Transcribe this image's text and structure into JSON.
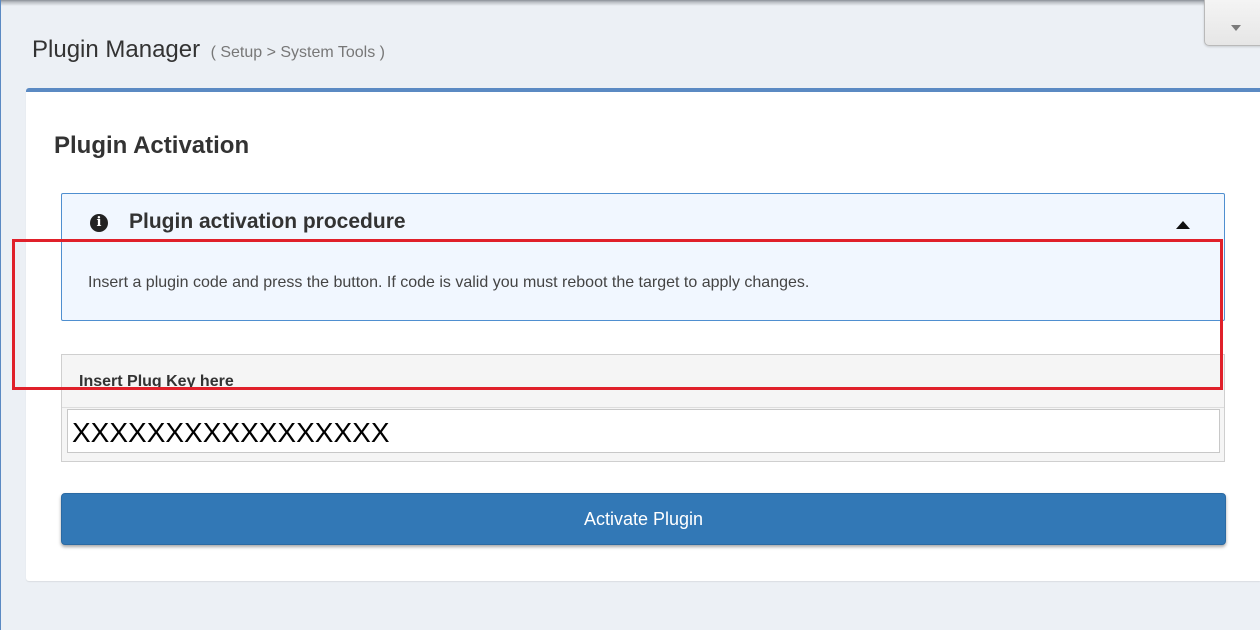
{
  "header": {
    "title": "Plugin Manager",
    "breadcrumb": "( Setup > System Tools )"
  },
  "box": {
    "title": "Plugin Activation",
    "alert": {
      "icon": "info-circle-icon",
      "heading": "Plugin activation procedure",
      "body": "Insert a plugin code and press the button. If code is valid you must reboot the target to apply changes.",
      "collapse_icon": "caret-up-icon"
    },
    "key": {
      "label": "Insert Plug Key here",
      "value": "XXXXXXXXXXXXXXXXX"
    },
    "activate_label": "Activate Plugin"
  },
  "corner_dropdown": {
    "icon": "caret-down-icon"
  },
  "colors": {
    "accent": "#3278b6",
    "box_border": "#5b8ac3",
    "alert_bg": "#f1f7ff",
    "alert_border": "#4f8fd0",
    "highlight": "#e0202a"
  }
}
